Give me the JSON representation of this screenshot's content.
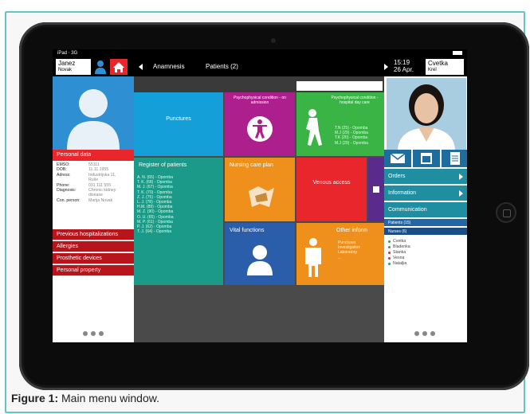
{
  "status": {
    "carrier": "iPad",
    "network": "3G"
  },
  "header": {
    "user_first": "Janez",
    "user_last": "Novak",
    "tab_anamnesis": "Anamnesis",
    "tab_patients": "Patients (2)",
    "time": "15:19",
    "date": "26 Apr.",
    "nurse_first": "Cvetka",
    "nurse_last": "Krel"
  },
  "left": {
    "personal_data": "Personal data",
    "fields": [
      {
        "k": "EMSO:",
        "v": "55111"
      },
      {
        "k": "DOB:",
        "v": "11.11.1955"
      },
      {
        "k": "Adress:",
        "v": "Industrijska 11,"
      },
      {
        "k": "",
        "v": "Ruše"
      },
      {
        "k": "Phone:",
        "v": "031 111 555"
      },
      {
        "k": "Diagnosis:",
        "v": "Chronic kidney"
      },
      {
        "k": "",
        "v": "disease"
      },
      {
        "k": "Con. person:",
        "v": "Marija Novak"
      }
    ],
    "menu": [
      "Previous hospitalizations",
      "Allergies",
      "Prosthetic devices",
      "Personal property"
    ]
  },
  "tiles": {
    "punctures": "Punctures",
    "psych_admission": "Psychophysical condition - on admission",
    "psych_hospital": "Psychophysical condition - hospital day care",
    "psych_list": [
      "T.N (25) - Opomba",
      "M.J (29) - Opomba",
      "T.K (20) - Opomba",
      "M.J (29) - Opomba"
    ],
    "register": "Register of patients",
    "register_list": [
      "A. N. (65) - Opomba",
      "T. K. (68) - Opomba",
      "M. J. (67) - Opomba",
      "T. K. (70) - Opomba",
      "Z. J. (75) - Opomba",
      "L. J. (78) - Opomba",
      "H.M. (89) - Opomba",
      "M. Z. (90) - Opomba",
      "O. U. (65) - Opomba",
      "M. P. (61) - Opomba",
      "P. J. (62) - Opomba",
      "T. J. (64) - Opomba"
    ],
    "nursing_care_plan": "Nursing care plan",
    "venous_access": "Venous access",
    "vital_functions": "Vital functions",
    "other_info": "Other inform",
    "other_list": [
      "Punctures",
      "Investigation",
      "Laboratory",
      "..."
    ]
  },
  "right": {
    "orders": "Orders",
    "information": "Information",
    "communication": "Communication",
    "patients_tab": "Patients (15)",
    "nurses_tab": "Nurses (6)",
    "nurses": [
      {
        "name": "Cvetka",
        "color": "#27a844"
      },
      {
        "name": "Bladenka",
        "color": "#27a844"
      },
      {
        "name": "Stanka",
        "color": "#e8262b"
      },
      {
        "name": "Vesna",
        "color": "#e8262b"
      },
      {
        "name": "Nataljia",
        "color": "#27a844"
      }
    ]
  },
  "caption": {
    "label": "Figure 1:",
    "text": " Main menu window."
  }
}
